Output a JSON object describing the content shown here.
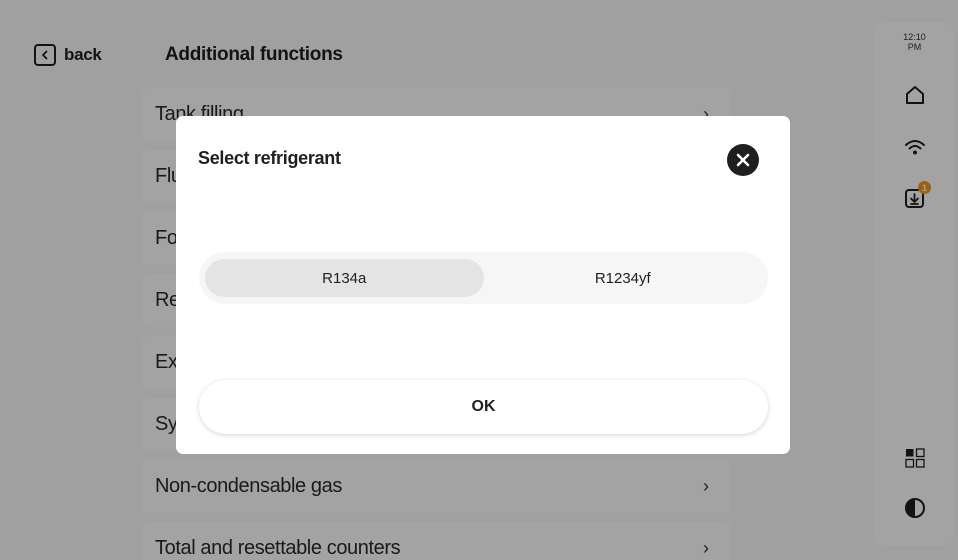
{
  "header": {
    "back_label": "back",
    "title": "Additional functions"
  },
  "menu": {
    "items": [
      {
        "label": "Tank filling",
        "chevron": "›"
      },
      {
        "label": "Flushing",
        "chevron": "›"
      },
      {
        "label": "Forced",
        "chevron": "›"
      },
      {
        "label": "Recovery",
        "chevron": "›"
      },
      {
        "label": "Exhausting",
        "chevron": "›"
      },
      {
        "label": "System",
        "chevron": "›"
      },
      {
        "label": "Non-condensable gas",
        "chevron": "›"
      },
      {
        "label": "Total and resettable counters",
        "chevron": "›"
      }
    ]
  },
  "rail": {
    "time": "12:10",
    "ampm": "PM",
    "download_badge": "1",
    "icons": [
      "home-icon",
      "wifi-icon",
      "download-icon",
      "grid-icon",
      "contrast-icon"
    ]
  },
  "dialog": {
    "title": "Select refrigerant",
    "options": [
      "R134a",
      "R1234yf"
    ],
    "selected": "R134a",
    "ok_label": "OK"
  },
  "colors": {
    "background": "#fafafa",
    "overlay": "rgba(0,0,0,0.36)",
    "text": "#1f1f1f",
    "badge": "#f39a1c",
    "selected_option": "#e4e4e4"
  }
}
